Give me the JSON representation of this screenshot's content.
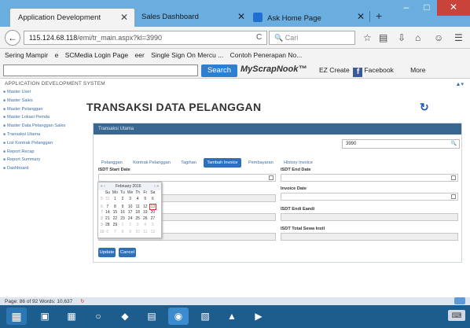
{
  "browser": {
    "tabs": [
      {
        "label": "Application Development",
        "active": true
      },
      {
        "label": "Sales Dashboard",
        "active": false
      },
      {
        "label": "Ask Home Page",
        "active": false
      }
    ],
    "new_tab": "+",
    "window_controls": {
      "minimize": "–",
      "maximize": "□",
      "close": "✕"
    },
    "url_host": "115.124.68.118",
    "url_path": "/emi/tr_main.aspx?kl=3990",
    "search_placeholder": "Cari",
    "bookmarks": [
      "Sering Mampir",
      "e",
      "SCMedia Login Page",
      "eer",
      "Single Sign On Mercu ...",
      "Contoh Penerapan No..."
    ],
    "toolbar": {
      "search_button": "Search",
      "brand": "MyScrapNook™",
      "ez_create": "EZ Create",
      "facebook": "Facebook",
      "more": "More"
    }
  },
  "page": {
    "app_name": "APPLICATION DEVELOPMENT SYSTEM",
    "sidebar": [
      "Master User",
      "Master Sales",
      "Master Pelanggan",
      "Master Lokasi Pemda",
      "Master Data Pelanggan Sales",
      "Transaksi Utama",
      "List Kontrak Pelanggan",
      "Report Recap",
      "Report Summary",
      "Dashboard"
    ],
    "title": "TRANSAKSI DATA PELANGGAN",
    "panel_title": "Transaksi Utama",
    "search_value": "3990",
    "tabs": [
      "Pelanggan",
      "Kontrak Pelanggan",
      "Tagihan",
      "Tambah Invoice",
      "Pembayaran",
      "History Invoice"
    ],
    "active_tab": "Tambah Invoice",
    "fields": {
      "start_date_label": "ISDT Start Date",
      "start_date_value": "|",
      "end_date_label": "ISDT End Date",
      "invoice_date_label": "Invoice Date",
      "isdt_endi_label": "ISDT Endi Eandi",
      "isdt_total_label": "ISDT Total Sewa Instl"
    },
    "buttons": {
      "update": "Update",
      "cancel": "Cancel"
    },
    "datepicker": {
      "month": "February 2016",
      "weekdays": [
        "Su",
        "Mo",
        "Tu",
        "We",
        "Th",
        "Fr",
        "Sa"
      ],
      "weeks": [
        [
          "5",
          "31",
          "1",
          "2",
          "3",
          "4",
          "5",
          "6"
        ],
        [
          "6",
          "7",
          "8",
          "9",
          "10",
          "11",
          "12",
          "13"
        ],
        [
          "7",
          "14",
          "15",
          "16",
          "17",
          "18",
          "19",
          "20"
        ],
        [
          "8",
          "21",
          "22",
          "23",
          "24",
          "25",
          "26",
          "27"
        ],
        [
          "9",
          "28",
          "29",
          "1",
          "2",
          "3",
          "4",
          "5"
        ],
        [
          "10",
          "6",
          "7",
          "8",
          "9",
          "10",
          "11",
          "12"
        ]
      ],
      "today": "13"
    }
  },
  "status": {
    "text": "Page: 86 of 92   Words: 10,637"
  },
  "colors": {
    "tabstrip": "#6aaee0",
    "accent": "#2d6fb8",
    "panel_head": "#39678f",
    "taskbar": "#1c5d8e"
  }
}
